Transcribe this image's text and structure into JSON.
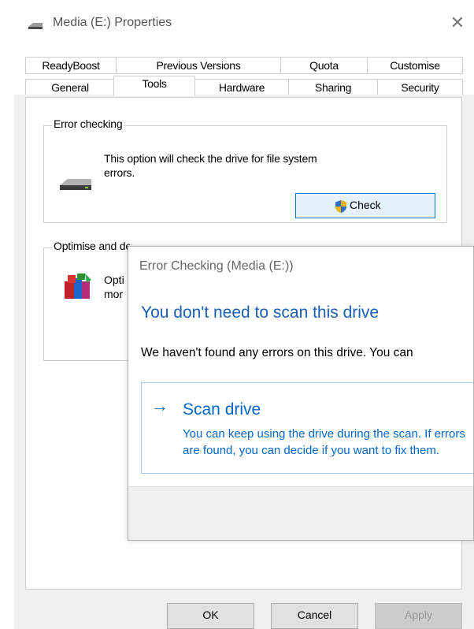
{
  "window": {
    "title": "Media (E:) Properties",
    "close_glyph": "✕"
  },
  "tabs": {
    "row1": [
      "ReadyBoost",
      "Previous Versions",
      "Quota",
      "Customise"
    ],
    "row2": [
      "General",
      "Tools",
      "Hardware",
      "Sharing",
      "Security"
    ],
    "active": "Tools"
  },
  "error_checking": {
    "legend": "Error checking",
    "description": "This option will check the drive for file system errors.",
    "button_label": "Check",
    "icon": "drive-icon",
    "button_icon": "shield-icon"
  },
  "optimise": {
    "legend": "Optimise and defragment drive",
    "visible_text_line1": "Opti",
    "visible_text_line2": "mor",
    "icon": "defrag-icon"
  },
  "error_dialog": {
    "title": "Error Checking (Media (E:))",
    "heading": "You don't need to scan this drive",
    "body": "We haven't found any errors on this drive. You can",
    "scan_option": {
      "arrow": "→",
      "title": "Scan drive",
      "description": "You can keep using the drive during the scan. If errors are found, you can decide if you want to fix them."
    }
  },
  "buttons": {
    "ok": "OK",
    "cancel": "Cancel",
    "apply": "Apply"
  },
  "colors": {
    "accent": "#0066cc",
    "heading_blue": "#1a5fb4",
    "button_focus_border": "#0078d7"
  }
}
